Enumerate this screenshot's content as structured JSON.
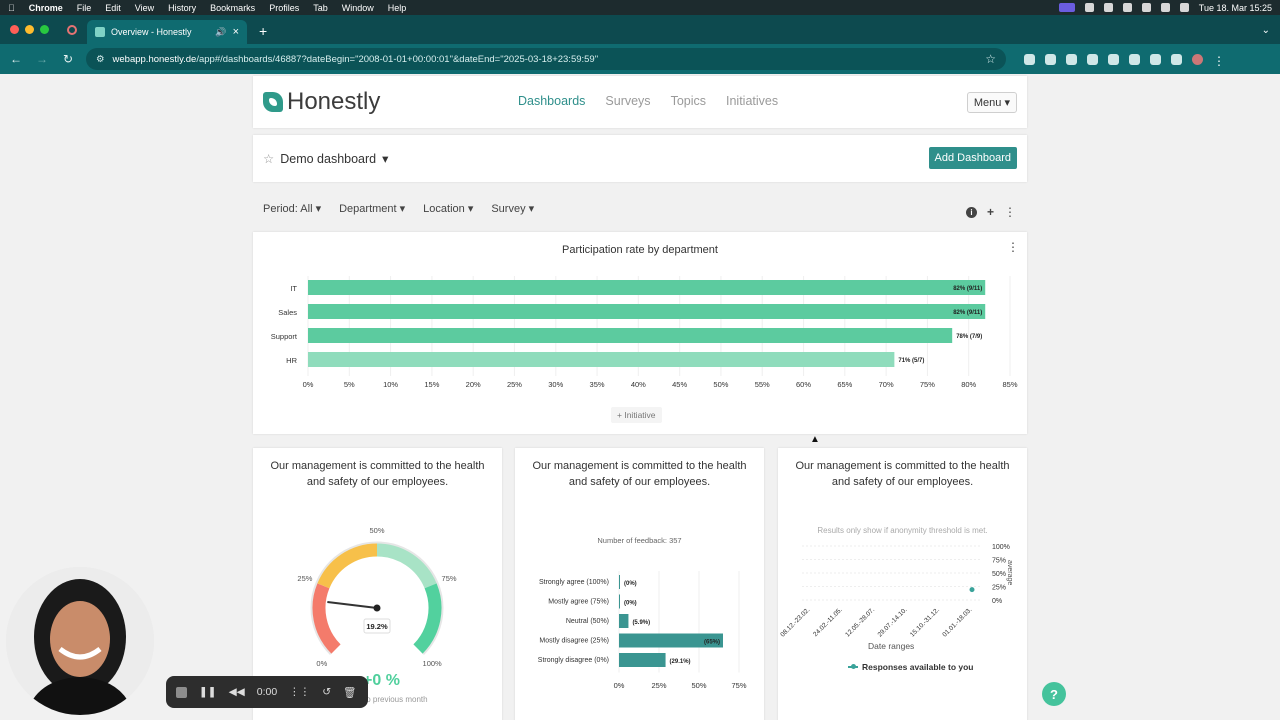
{
  "menubar": {
    "app": "Chrome",
    "items": [
      "File",
      "Edit",
      "View",
      "History",
      "Bookmarks",
      "Profiles",
      "Tab",
      "Window",
      "Help"
    ],
    "clock": "Tue 18. Mar 15:25"
  },
  "browser": {
    "tab_title": "Overview - Honestly",
    "url_host": "webapp.honestly.de",
    "url_path": "/app#/dashboards/46887?dateBegin=\"2008-01-01+00:00:01\"&dateEnd=\"2025-03-18+23:59:59\""
  },
  "header": {
    "logo_text": "Honestly",
    "nav": [
      "Dashboards",
      "Surveys",
      "Topics",
      "Initiatives"
    ],
    "menu_label": "Menu"
  },
  "dashboard": {
    "title": "Demo dashboard",
    "add_button": "Add Dashboard",
    "filters": [
      "Period: All",
      "Department",
      "Location",
      "Survey"
    ]
  },
  "participation_chart": {
    "title": "Participation rate by department",
    "initiative_label": "Initiative"
  },
  "chart_data": [
    {
      "type": "bar",
      "orientation": "horizontal",
      "title": "Participation rate by department",
      "categories": [
        "IT",
        "Sales",
        "Support",
        "HR"
      ],
      "values": [
        82,
        82,
        78,
        71
      ],
      "data_labels": [
        "82% (9/11)",
        "82% (9/11)",
        "78% (7/9)",
        "71% (5/7)"
      ],
      "x_ticks": [
        "0%",
        "5%",
        "10%",
        "15%",
        "20%",
        "25%",
        "30%",
        "35%",
        "40%",
        "45%",
        "50%",
        "55%",
        "60%",
        "65%",
        "70%",
        "75%",
        "80%",
        "85%"
      ],
      "xlim": [
        0,
        85
      ],
      "colors": [
        "#5ccb9f",
        "#5ccb9f",
        "#5ccb9f",
        "#8fdcbc"
      ]
    },
    {
      "type": "gauge",
      "title": "Our management is committed to the health and safety of our employees.",
      "value": 19.2,
      "value_label": "19.2%",
      "tick_labels": [
        "0%",
        "25%",
        "50%",
        "75%",
        "100%"
      ],
      "change_label": "+0 %",
      "change_sub": "to previous month"
    },
    {
      "type": "bar",
      "orientation": "horizontal",
      "title": "Our management is committed to the health and safety of our employees.",
      "subtitle": "Number of feedback: 357",
      "categories": [
        "Strongly agree (100%)",
        "Mostly agree (75%)",
        "Neutral (50%)",
        "Mostly disagree (25%)",
        "Strongly disagree (0%)"
      ],
      "values": [
        0,
        0,
        5.9,
        65,
        29.1
      ],
      "data_labels": [
        "(0%)",
        "(0%)",
        "(5.9%)",
        "(65%)",
        "(29.1%)"
      ],
      "x_ticks": [
        "0%",
        "25%",
        "50%",
        "75%"
      ],
      "xlim": [
        0,
        75
      ],
      "color": "#3a9591"
    },
    {
      "type": "line",
      "title": "Our management is committed to the health and safety of our employees.",
      "note": "Results only show if anonymity threshold is met.",
      "x": [
        "08.12.-23.02.",
        "24.02.-11.05.",
        "12.05.-28.07.",
        "29.07.-14.10.",
        "15.10.-31.12.",
        "01.01.-18.03."
      ],
      "series": [
        {
          "name": "Responses available to you",
          "values": [
            null,
            null,
            null,
            null,
            null,
            19.2
          ]
        }
      ],
      "y_ticks": [
        "0%",
        "25%",
        "50%",
        "75%",
        "100%"
      ],
      "ylim": [
        0,
        100
      ],
      "xlabel": "Date ranges",
      "ylabel": "average"
    }
  ],
  "gauge_card": {
    "title": "Our management is committed to the health and safety of our employees.",
    "change": "+0 %",
    "change_sub": "to previous month"
  },
  "feedback_card": {
    "title": "Our management is committed to the health and safety of our employees.",
    "count": "Number of feedback: 357"
  },
  "trend_card": {
    "title": "Our management is committed to the health and safety of our employees.",
    "note": "Results only show if anonymity threshold is met.",
    "xlabel": "Date ranges",
    "legend": "Responses available to you"
  },
  "recorder": {
    "time": "0:00"
  },
  "help_label": "?"
}
